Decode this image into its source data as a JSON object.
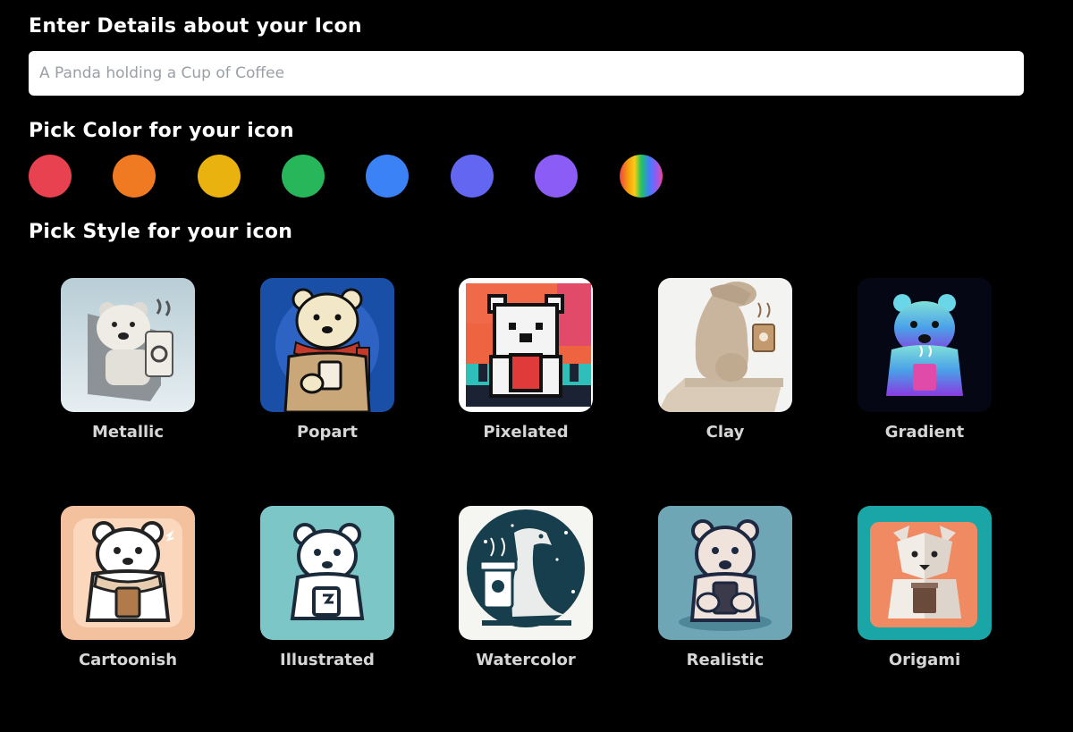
{
  "details": {
    "title": "Enter Details about your Icon",
    "placeholder": "A Panda holding a Cup of Coffee",
    "value": ""
  },
  "colors": {
    "title": "Pick Color for your icon",
    "swatches": [
      {
        "name": "red",
        "color": "#e8414f"
      },
      {
        "name": "orange",
        "color": "#f07a22"
      },
      {
        "name": "yellow",
        "color": "#eab20e"
      },
      {
        "name": "green",
        "color": "#27b75a"
      },
      {
        "name": "blue",
        "color": "#3b82f6"
      },
      {
        "name": "indigo",
        "color": "#6366f1"
      },
      {
        "name": "violet",
        "color": "#8b5cf6"
      },
      {
        "name": "rainbow",
        "color": "multicolor"
      }
    ]
  },
  "styles": {
    "title": "Pick Style for your icon",
    "items": [
      {
        "label": "Metallic",
        "icon": "polar-bear-metallic-icon"
      },
      {
        "label": "Popart",
        "icon": "polar-bear-popart-icon"
      },
      {
        "label": "Pixelated",
        "icon": "polar-bear-pixelated-icon"
      },
      {
        "label": "Clay",
        "icon": "polar-bear-clay-icon"
      },
      {
        "label": "Gradient",
        "icon": "polar-bear-gradient-icon"
      },
      {
        "label": "Cartoonish",
        "icon": "polar-bear-cartoonish-icon"
      },
      {
        "label": "Illustrated",
        "icon": "polar-bear-illustrated-icon"
      },
      {
        "label": "Watercolor",
        "icon": "polar-bear-watercolor-icon"
      },
      {
        "label": "Realistic",
        "icon": "polar-bear-realistic-icon"
      },
      {
        "label": "Origami",
        "icon": "polar-bear-origami-icon"
      }
    ]
  }
}
